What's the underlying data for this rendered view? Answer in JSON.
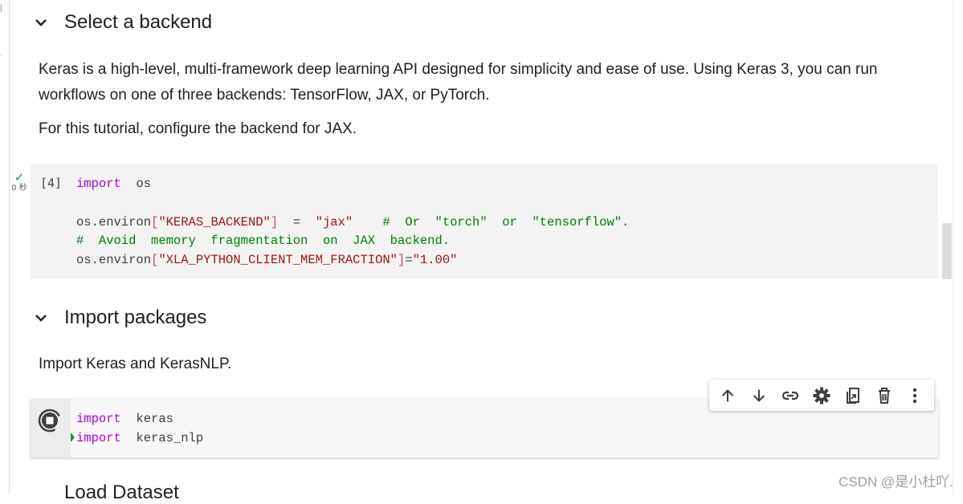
{
  "sections": {
    "backend": {
      "heading": "Select a backend",
      "para1": "Keras is a high-level, multi-framework deep learning API designed for simplicity and ease of use. Using Keras 3, you can run workflows on one of three backends: TensorFlow, JAX, or PyTorch.",
      "para2": "For this tutorial, configure the backend for JAX."
    },
    "imports": {
      "heading": "Import packages",
      "para": "Import Keras and KerasNLP."
    },
    "next": {
      "heading": "Load Dataset"
    }
  },
  "cell1": {
    "exec_count": "[4]",
    "status_time": "0 秒",
    "lines": {
      "l1_kw": "import",
      "l1_rest": "  os",
      "l3_a": "os.environ",
      "l3_b": "[",
      "l3_key": "\"KERAS_BACKEND\"",
      "l3_c": "]",
      "l3_eq": "  =  ",
      "l3_val": "\"jax\"",
      "l3_com": "    #  Or  \"torch\"  or  \"tensorflow\".",
      "l4_com": "#  Avoid  memory  fragmentation  on  JAX  backend.",
      "l5_a": "os.environ",
      "l5_b": "[",
      "l5_key": "\"XLA_PYTHON_CLIENT_MEM_FRACTION\"",
      "l5_c": "]",
      "l5_eq": "=",
      "l5_val": "\"1.00\""
    }
  },
  "cell2": {
    "l1_kw": "import",
    "l1_rest": "  keras",
    "l2_kw": "import",
    "l2_rest": "  keras_nlp"
  },
  "toolbar": {
    "icons": [
      "arrow-up-icon",
      "arrow-down-icon",
      "link-icon",
      "gear-icon",
      "mirror-cell-icon",
      "trash-icon",
      "more-vert-icon"
    ]
  },
  "watermark": "CSDN @是小杜吖.",
  "colors": {
    "keyword": "#af00db",
    "string": "#a31515",
    "comment": "#008000",
    "cell_bg": "#f3f3f3"
  }
}
